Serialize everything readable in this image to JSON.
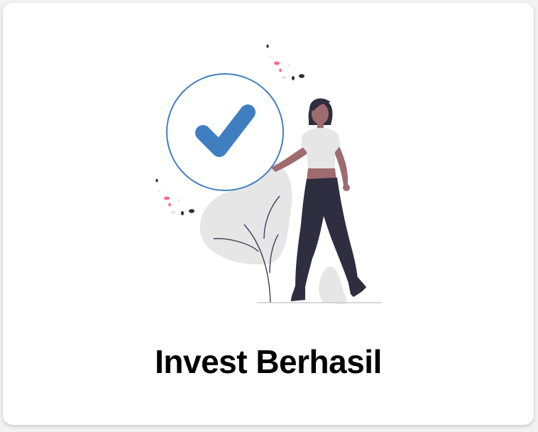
{
  "dialog": {
    "title": "Invest Berhasil"
  },
  "illustration": {
    "name": "success-checkmark-illustration",
    "colors": {
      "check": "#3f7ec1",
      "circle_stroke": "#3f7ec1",
      "skin": "#9e6b6f",
      "pants": "#2f2e41",
      "shirt": "#e6e6e6",
      "plant": "#e6e6e6",
      "accent_dot": "#ff6584"
    }
  }
}
